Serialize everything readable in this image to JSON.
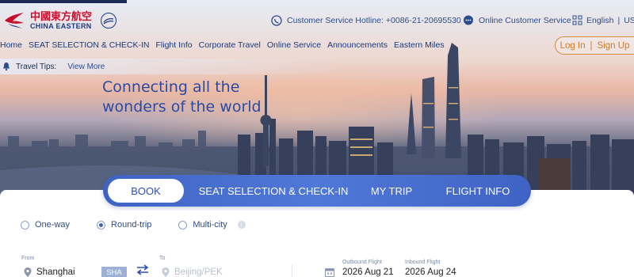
{
  "brand": {
    "name_cn": "中國東方航空",
    "name_en": "CHINA EASTERN"
  },
  "header": {
    "hotline": "Customer Service Hotline: +0086-21-20695530",
    "online_service": "Online Customer Service",
    "language": "English",
    "currency": "USD"
  },
  "nav": {
    "items": [
      "Home",
      "SEAT SELECTION & CHECK-IN",
      "Flight Info",
      "Corporate Travel",
      "Online Service",
      "Announcements",
      "Eastern Miles"
    ],
    "login": "Log In",
    "signup": "Sign Up"
  },
  "tips": {
    "label": "Travel Tips:",
    "link": "View More"
  },
  "hero": {
    "line1": "Connecting all the",
    "line2": "wonders of the world"
  },
  "tabs": [
    "BOOK",
    "SEAT SELECTION & CHECK-IN",
    "MY TRIP",
    "FLIGHT INFO"
  ],
  "trip_types": {
    "options": [
      "One-way",
      "Round-trip",
      "Multi-city"
    ],
    "selected": "Round-trip"
  },
  "search": {
    "from_label": "From",
    "from_value": "Shanghai",
    "from_code": "SHA",
    "to_label": "To",
    "to_placeholder": "Beijing/PEK",
    "outbound_label": "Outbound Flight",
    "outbound_value": "2026 Aug 21",
    "inbound_label": "Inbound Flight",
    "inbound_value": "2026 Aug 24"
  },
  "colors": {
    "brand_red": "#c8102e",
    "brand_blue": "#2c4fb5",
    "login_orange": "#d07a2a"
  }
}
